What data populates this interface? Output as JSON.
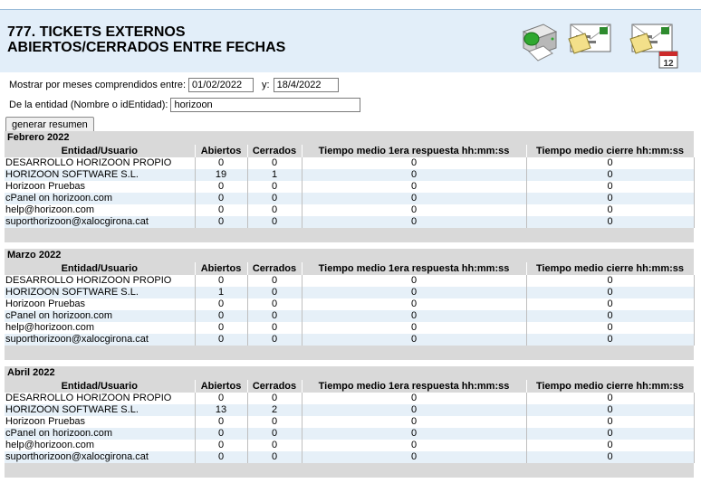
{
  "header": {
    "title_line1": "777. TICKETS EXTERNOS",
    "title_line2": "ABIERTOS/CERRADOS ENTRE FECHAS",
    "icons": [
      "printer-icon",
      "email-icon",
      "email-schedule-icon"
    ],
    "calendar_badge": "12"
  },
  "form": {
    "range_label": "Mostrar por meses comprendidos entre:",
    "date_from": "01/02/2022",
    "and_label": "y:",
    "date_to": "18/4/2022",
    "entity_label": "De la entidad (Nombre o idEntidad):",
    "entity_value": "horizoon",
    "submit_label": "generar resumen"
  },
  "columns": [
    "Entidad/Usuario",
    "Abiertos",
    "Cerrados",
    "Tiempo medio 1era respuesta hh:mm:ss",
    "Tiempo medio cierre hh:mm:ss"
  ],
  "months": [
    {
      "name": "Febrero 2022",
      "rows": [
        [
          "DESARROLLO HORIZOON PROPIO",
          "0",
          "0",
          "0",
          "0"
        ],
        [
          "HORIZOON SOFTWARE S.L.",
          "19",
          "1",
          "0",
          "0"
        ],
        [
          "Horizoon Pruebas",
          "0",
          "0",
          "0",
          "0"
        ],
        [
          "cPanel on horizoon.com",
          "0",
          "0",
          "0",
          "0"
        ],
        [
          "help@horizoon.com",
          "0",
          "0",
          "0",
          "0"
        ],
        [
          "suporthorizoon@xalocgirona.cat",
          "0",
          "0",
          "0",
          "0"
        ]
      ]
    },
    {
      "name": "Marzo 2022",
      "rows": [
        [
          "DESARROLLO HORIZOON PROPIO",
          "0",
          "0",
          "0",
          "0"
        ],
        [
          "HORIZOON SOFTWARE S.L.",
          "1",
          "0",
          "0",
          "0"
        ],
        [
          "Horizoon Pruebas",
          "0",
          "0",
          "0",
          "0"
        ],
        [
          "cPanel on horizoon.com",
          "0",
          "0",
          "0",
          "0"
        ],
        [
          "help@horizoon.com",
          "0",
          "0",
          "0",
          "0"
        ],
        [
          "suporthorizoon@xalocgirona.cat",
          "0",
          "0",
          "0",
          "0"
        ]
      ]
    },
    {
      "name": "Abril 2022",
      "rows": [
        [
          "DESARROLLO HORIZOON PROPIO",
          "0",
          "0",
          "0",
          "0"
        ],
        [
          "HORIZOON SOFTWARE S.L.",
          "13",
          "2",
          "0",
          "0"
        ],
        [
          "Horizoon Pruebas",
          "0",
          "0",
          "0",
          "0"
        ],
        [
          "cPanel on horizoon.com",
          "0",
          "0",
          "0",
          "0"
        ],
        [
          "help@horizoon.com",
          "0",
          "0",
          "0",
          "0"
        ],
        [
          "suporthorizoon@xalocgirona.cat",
          "0",
          "0",
          "0",
          "0"
        ]
      ]
    }
  ],
  "colors": {
    "header_bg": "#e2eef9",
    "section_bg": "#d9d9d9",
    "row_alt_bg": "#e6f0f8"
  }
}
